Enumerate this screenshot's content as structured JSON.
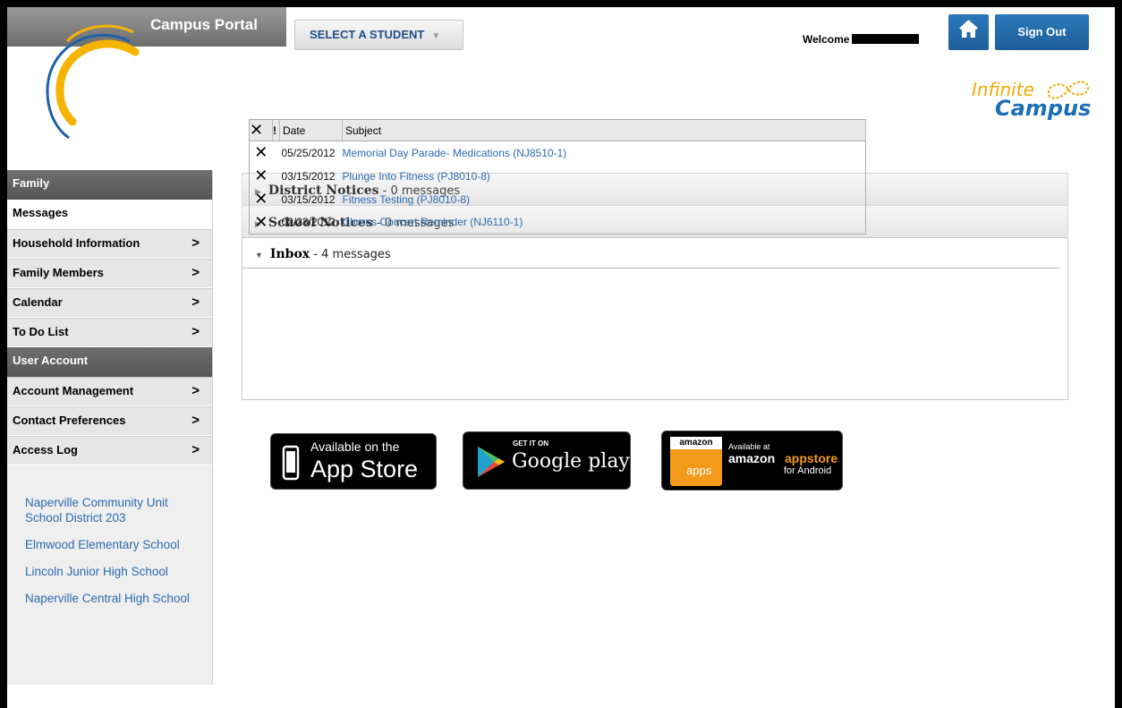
{
  "header": {
    "portal_title": "Campus Portal",
    "student_select_label": "SELECT A STUDENT",
    "welcome_text": "Welcome",
    "signout_label": "Sign Out",
    "brand_line1": "Infinite",
    "brand_line2": "Campus"
  },
  "sidebar": {
    "sections": [
      {
        "title": "Family"
      },
      {
        "title": "User Account"
      }
    ],
    "family_items": [
      {
        "label": "Messages",
        "active": true
      },
      {
        "label": "Household Information"
      },
      {
        "label": "Family Members"
      },
      {
        "label": "Calendar"
      },
      {
        "label": "To Do List"
      }
    ],
    "account_items": [
      {
        "label": "Account Management"
      },
      {
        "label": "Contact Preferences"
      },
      {
        "label": "Access Log"
      }
    ],
    "school_links": [
      "Naperville Community Unit School District 203",
      "Elmwood Elementary School",
      "Lincoln Junior High School",
      "Naperville Central High School"
    ]
  },
  "main": {
    "district_notices": {
      "title": "District Notices",
      "count": " - 0 messages"
    },
    "school_notices": {
      "title": "School Notices",
      "count": " - 0 messages"
    },
    "inbox": {
      "title": "Inbox",
      "count": " - 4 messages"
    },
    "table": {
      "col_date": "Date",
      "col_subject": "Subject",
      "rows": [
        {
          "date": "05/25/2012",
          "subject": "Memorial Day Parade- Medications (NJ8510-1)"
        },
        {
          "date": "03/15/2012",
          "subject": "Plunge Into Fitness (PJ8010-8)"
        },
        {
          "date": "03/15/2012",
          "subject": "Fitness Testing (PJ8010-8)"
        },
        {
          "date": "02/23/2012",
          "subject": "Chorus Concert Reminder (NJ6110-1)"
        }
      ]
    }
  },
  "badges": {
    "apple": {
      "line1": "Available on the",
      "line2": "App Store"
    },
    "google": {
      "line1": "GET IT ON",
      "line2": "Google play"
    },
    "amazon": {
      "logo": "amazon",
      "apps": "apps",
      "line1": "Available at",
      "line2a": "amazon",
      "line2b": "appstore",
      "line3": "for Android"
    }
  },
  "colors": {
    "link": "#2a6bb0",
    "button_blue": "#1e5f98",
    "sidebar_header": "#606060",
    "brand_orange": "#f2a900"
  },
  "icons": [
    "home-icon",
    "delete-x-icon",
    "important-icon",
    "chevron-right-icon",
    "triangle-right-icon",
    "triangle-down-icon",
    "apple-icon",
    "google-play-icon"
  ]
}
